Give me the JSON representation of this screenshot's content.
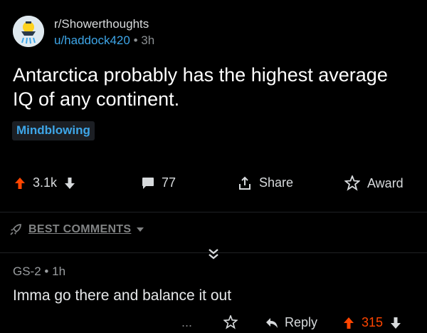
{
  "post": {
    "subreddit": "r/Showerthoughts",
    "username": "u/haddock420",
    "separator": "•",
    "age": "3h",
    "title": "Antarctica probably has the highest average IQ of any continent.",
    "flair": "Mindblowing",
    "actions": {
      "upvotes": "3.1k",
      "comments": "77",
      "share": "Share",
      "award": "Award"
    }
  },
  "comments_header": {
    "sort_label": "BEST COMMENTS"
  },
  "comment": {
    "author": "GS-2",
    "separator": "•",
    "age": "1h",
    "body": "Imma go there and balance it out",
    "more": "...",
    "reply": "Reply",
    "score": "315"
  },
  "colors": {
    "background": "#000000",
    "upvote": "#ff4500",
    "link": "#3ea6e8",
    "text": "#d7dadc"
  }
}
